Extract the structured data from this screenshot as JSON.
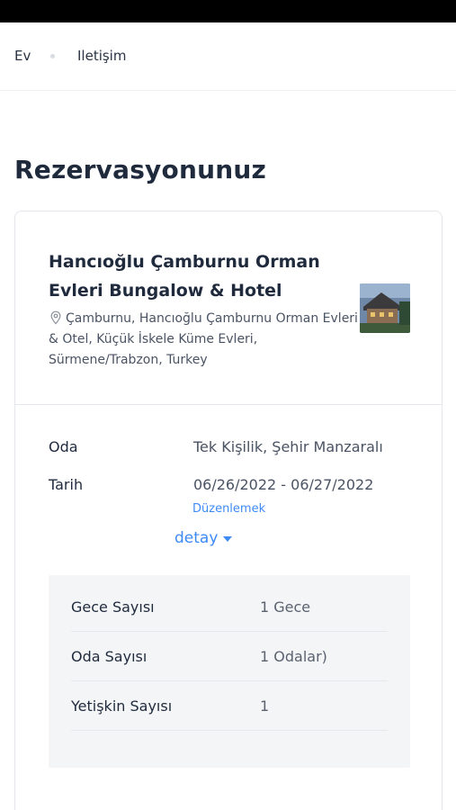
{
  "breadcrumb": {
    "home": "Ev",
    "contact": "Iletişim"
  },
  "page_title": "Rezervasyonunuz",
  "hotel": {
    "name_line1": "Hancıoğlu Çamburnu Orman",
    "name_line2": "Evleri Bungalow & Hotel",
    "address": "Çamburnu, Hancıoğlu Çamburnu Orman Evleri & Otel, Küçük İskele Küme Evleri, Sürmene/Trabzon, Turkey"
  },
  "booking": {
    "room_label": "Oda",
    "room_value": "Tek Kişilik, Şehir Manzaralı",
    "date_label": "Tarih",
    "date_value": "06/26/2022 - 06/27/2022",
    "edit_label": "Düzenlemek",
    "detail_toggle": "detay"
  },
  "details": [
    {
      "label": "Gece Sayısı",
      "value": "1 Gece"
    },
    {
      "label": "Oda Sayısı",
      "value": "1 Odalar)"
    },
    {
      "label": "Yetişkin Sayısı",
      "value": "1"
    }
  ],
  "colors": {
    "accent": "#3d8af7",
    "text": "#1f2a3d",
    "panel": "#f4f5f6"
  }
}
